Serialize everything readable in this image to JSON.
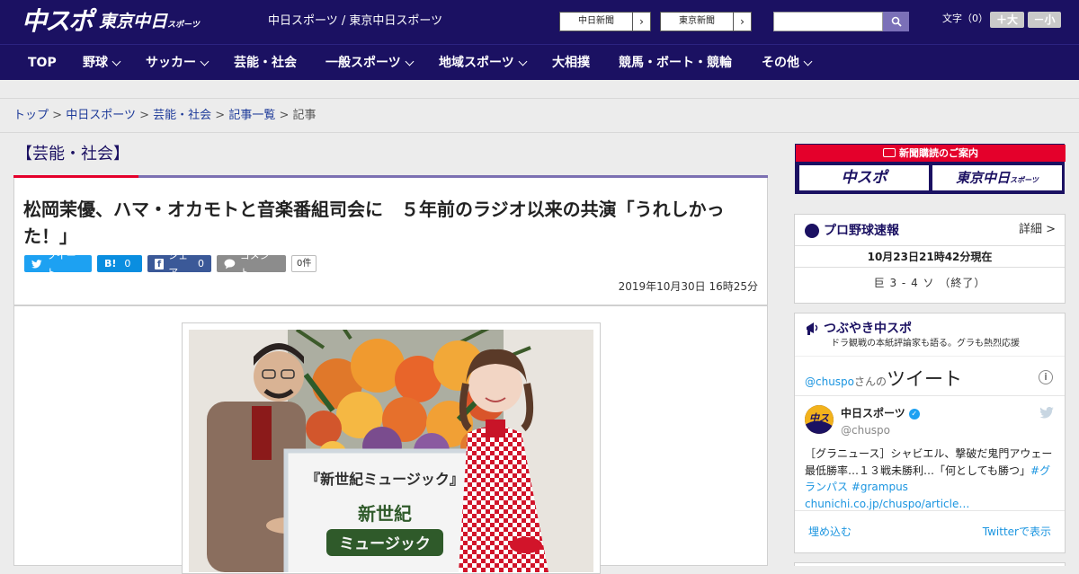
{
  "header": {
    "logo_chuspo": "中スポ",
    "logo_tokyo": "東京中日",
    "logo_tokyo_small": "スポーツ",
    "site_title": "中日スポーツ / 東京中日スポーツ",
    "sister_links": [
      "中日新聞",
      "東京新聞"
    ],
    "search_placeholder": "",
    "font_size_label": "文字（0）",
    "font_plus": "＋大",
    "font_minus": "－小"
  },
  "nav": {
    "items": [
      {
        "label": "TOP",
        "dropdown": false
      },
      {
        "label": "野球",
        "dropdown": true
      },
      {
        "label": "サッカー",
        "dropdown": true
      },
      {
        "label": "芸能・社会",
        "dropdown": false
      },
      {
        "label": "一般スポーツ",
        "dropdown": true
      },
      {
        "label": "地域スポーツ",
        "dropdown": true
      },
      {
        "label": "大相撲",
        "dropdown": false
      },
      {
        "label": "競馬・ボート・競輪",
        "dropdown": false
      },
      {
        "label": "その他",
        "dropdown": true
      }
    ]
  },
  "breadcrumb": {
    "items": [
      "トップ",
      "中日スポーツ",
      "芸能・社会",
      "記事一覧"
    ],
    "current": "記事",
    "separator": ">"
  },
  "article": {
    "section": "【芸能・社会】",
    "title": "松岡茉優、ハマ・オカモトと音楽番組司会に　５年前のラジオ以来の共演「うれしかった！」",
    "share": {
      "tweet": "ツイート",
      "hatena_logo": "B!",
      "hatena_count": "0",
      "facebook": "シェア",
      "facebook_count": "0",
      "comment": "コメント",
      "comment_count": "0件"
    },
    "date": "2019年10月30日 16時25分",
    "photo_sign_text": "『新世紀ミュージック』",
    "photo_logo_text": [
      "新世紀",
      "ミュージック"
    ]
  },
  "sidebar": {
    "subscription": {
      "title": "新聞購読のご案内",
      "brand_left": "中スポ",
      "brand_right": "東京中日",
      "brand_right_small": "スポーツ"
    },
    "baseball": {
      "title": "プロ野球速報",
      "detail": "詳細 >",
      "timestamp": "10月23日21時42分現在",
      "score": "巨 3 - 4 ソ （終了）"
    },
    "twitter": {
      "title": "つぶやき中スポ",
      "subtitle": "ドラ観戦の本紙評論家も語る。グラも熱烈応援",
      "user_prefix": "@chuspo",
      "user_suffix": "さんの",
      "heading": "ツイート",
      "name": "中日スポーツ",
      "handle": "@chuspo",
      "tweet_text": "［グラニュース］シャビエル、撃破だ鬼門アウェー　最低勝率…１３戦未勝利…「何としても勝つ」",
      "hashtags": "#グランパス #grampus",
      "link": "chunichi.co.jp/chuspo/article…",
      "embed": "埋め込む",
      "view": "Twitterで表示"
    }
  },
  "colors": {
    "brand_navy": "#1b1162",
    "accent_red": "#e4002b",
    "twitter_blue": "#1da1f2",
    "facebook_blue": "#3b5998"
  }
}
